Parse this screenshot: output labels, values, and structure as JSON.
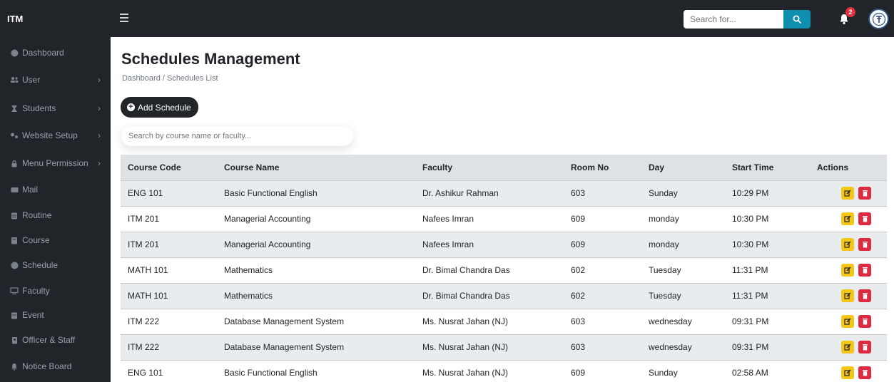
{
  "topbar": {
    "brand": "ITM",
    "search_placeholder": "Search for...",
    "notification_count": "2",
    "accent_color": "#0f8fb0"
  },
  "sidebar": {
    "items": [
      {
        "label": "Dashboard",
        "icon": "dashboard-icon",
        "has_children": false
      },
      {
        "label": "User",
        "icon": "users-icon",
        "has_children": true
      },
      {
        "label": "Students",
        "icon": "graduation-icon",
        "has_children": true
      },
      {
        "label": "Website Setup",
        "icon": "gears-icon",
        "has_children": true
      },
      {
        "label": "Menu Permission",
        "icon": "lock-icon",
        "has_children": true
      },
      {
        "label": "Mail",
        "icon": "mail-icon",
        "has_children": false
      },
      {
        "label": "Routine",
        "icon": "calendar-icon",
        "has_children": false
      },
      {
        "label": "Course",
        "icon": "book-icon",
        "has_children": false
      },
      {
        "label": "Schedule",
        "icon": "clock-icon",
        "has_children": false
      },
      {
        "label": "Faculty",
        "icon": "chalkboard-icon",
        "has_children": false
      },
      {
        "label": "Event",
        "icon": "calendar-event-icon",
        "has_children": false
      },
      {
        "label": "Officer & Staff",
        "icon": "id-badge-icon",
        "has_children": false
      },
      {
        "label": "Notice Board",
        "icon": "bell-icon",
        "has_children": false
      }
    ]
  },
  "main": {
    "title": "Schedules Management",
    "breadcrumb": "Dashboard  /  Schedules List",
    "add_button_label": "Add Schedule",
    "filter_placeholder": "Search by course name or faculty..."
  },
  "table": {
    "headers": [
      "Course Code",
      "Course Name",
      "Faculty",
      "Room No",
      "Day",
      "Start Time",
      "Actions"
    ],
    "rows": [
      [
        "ENG 101",
        "Basic Functional English",
        "Dr. Ashikur Rahman",
        "603",
        "Sunday",
        "10:29 PM"
      ],
      [
        "ITM 201",
        "Managerial Accounting",
        "Nafees Imran",
        "609",
        "monday",
        "10:30 PM"
      ],
      [
        "ITM 201",
        "Managerial Accounting",
        "Nafees Imran",
        "609",
        "monday",
        "10:30 PM"
      ],
      [
        "MATH 101",
        "Mathematics",
        "Dr. Bimal Chandra Das",
        "602",
        "Tuesday",
        "11:31 PM"
      ],
      [
        "MATH 101",
        "Mathematics",
        "Dr. Bimal Chandra Das",
        "602",
        "Tuesday",
        "11:31 PM"
      ],
      [
        "ITM 222",
        "Database Management System",
        "Ms. Nusrat Jahan (NJ)",
        "603",
        "wednesday",
        "09:31 PM"
      ],
      [
        "ITM 222",
        "Database Management System",
        "Ms. Nusrat Jahan (NJ)",
        "603",
        "wednesday",
        "09:31 PM"
      ],
      [
        "ENG 101",
        "Basic Functional English",
        "Ms. Nusrat Jahan (NJ)",
        "609",
        "Sunday",
        "02:58 AM"
      ]
    ],
    "edit_color": "#f5c518",
    "delete_color": "#dc2b3f"
  }
}
